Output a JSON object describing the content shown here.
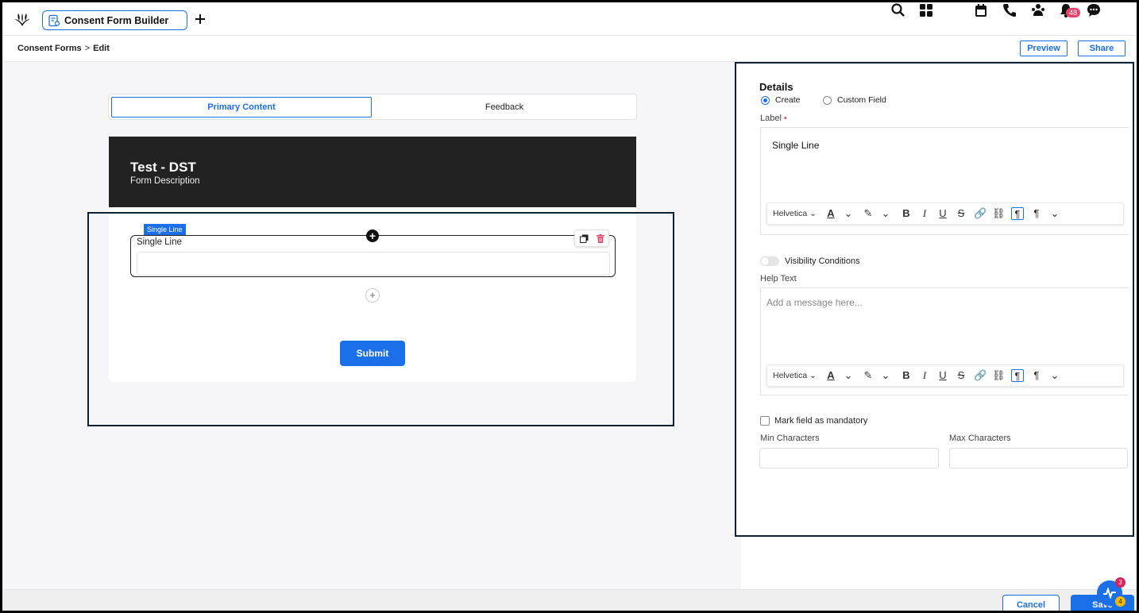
{
  "app": {
    "tab_title": "Consent Form Builder",
    "notification_count": "48"
  },
  "breadcrumb": {
    "root": "Consent Forms",
    "separator": ">",
    "current": "Edit"
  },
  "header_actions": {
    "preview_label": "Preview",
    "share_label": "Share"
  },
  "form_tabs": [
    {
      "label": "Primary Content",
      "active": true
    },
    {
      "label": "Feedback",
      "active": false
    }
  ],
  "form": {
    "title": "Test - DST",
    "description": "Form Description",
    "field_tag": "Single Line",
    "field_label": "Single Line",
    "submit_label": "Submit"
  },
  "details": {
    "title": "Details",
    "radio_create": "Create",
    "radio_custom": "Custom Field",
    "label_title": "Label",
    "label_required_mark": "•",
    "label_value": "Single Line",
    "font_name": "Helvetica",
    "visibility_label": "Visibility Conditions",
    "help_text_title": "Help Text",
    "help_text_placeholder": "Add a message here...",
    "mandatory_label": "Mark field as mandatory",
    "min_chars_label": "Min Characters",
    "max_chars_label": "Max Characters"
  },
  "footer": {
    "cancel_label": "Cancel",
    "save_label": "Save",
    "fab_badge_top": "3",
    "fab_badge_bottom": "4"
  },
  "colors": {
    "accent": "#1b6fe8",
    "header_dark": "#222222",
    "badge": "#e8446a",
    "badge_yellow": "#f2b705",
    "highlight_border": "#0c2233"
  }
}
